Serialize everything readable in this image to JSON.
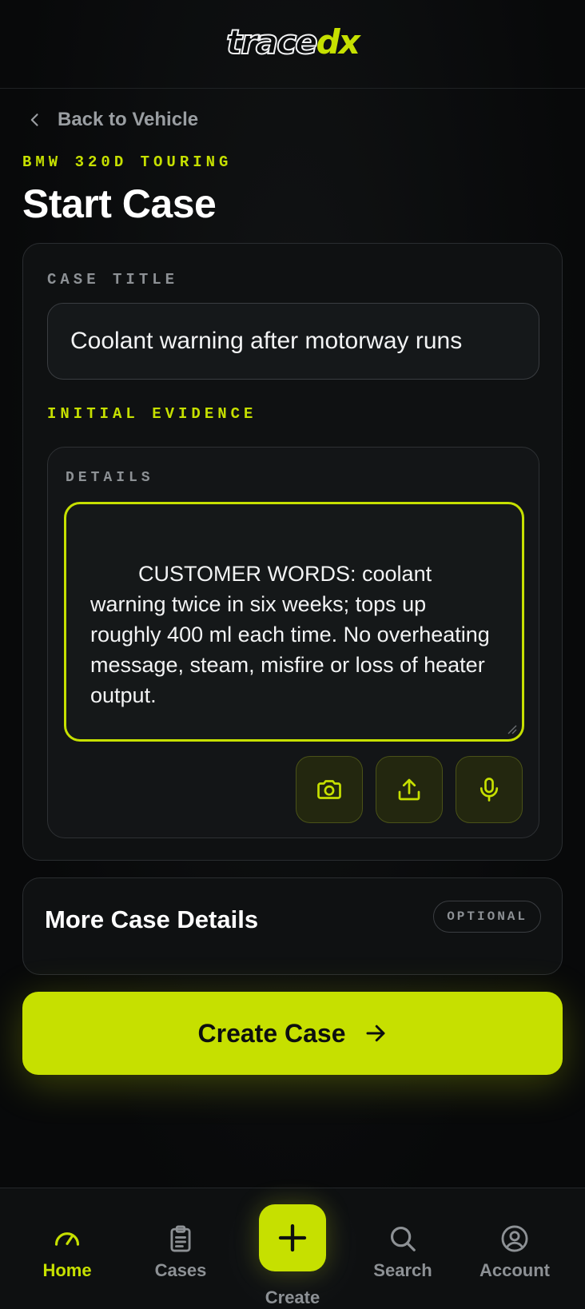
{
  "app": {
    "logo_part1": "trace",
    "logo_part2": "dx"
  },
  "nav_back": {
    "label": "Back to Vehicle"
  },
  "page": {
    "vehicle": "BMW 320D TOURING",
    "title": "Start Case"
  },
  "form": {
    "case_title_label": "CASE TITLE",
    "case_title_value": "Coolant warning after motorway runs",
    "evidence_label": "INITIAL EVIDENCE",
    "details_label": "DETAILS",
    "details_value": "CUSTOMER WORDS: coolant warning twice in six weeks; tops up roughly 400 ml each time. No overheating message, steam, misfire or loss of heater output.\n\nCHECKS TODAY:\nCooling system pressure holds when",
    "tools": [
      "camera-icon",
      "upload-icon",
      "microphone-icon"
    ]
  },
  "more_details": {
    "title": "More Case Details",
    "badge": "OPTIONAL"
  },
  "cta": {
    "label": "Create Case"
  },
  "bottom_nav": {
    "home": "Home",
    "cases": "Cases",
    "create": "Create",
    "search": "Search",
    "account": "Account",
    "active": "home"
  },
  "colors": {
    "accent": "#c6e000",
    "background": "#0a0b0c",
    "muted": "#8d9195"
  }
}
